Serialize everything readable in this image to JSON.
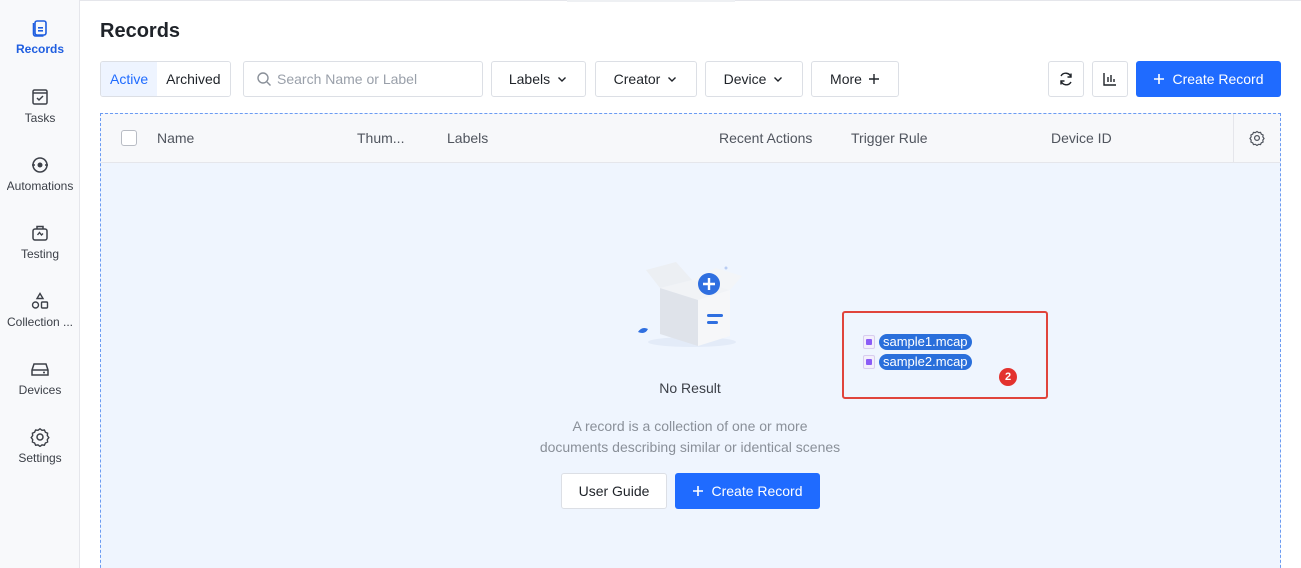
{
  "sidebar": {
    "items": [
      {
        "label": "Records",
        "icon": "records-icon",
        "active": true
      },
      {
        "label": "Tasks",
        "icon": "tasks-icon"
      },
      {
        "label": "Automations",
        "icon": "automations-icon"
      },
      {
        "label": "Testing",
        "icon": "testing-icon"
      },
      {
        "label": "Collection ...",
        "icon": "collection-icon"
      },
      {
        "label": "Devices",
        "icon": "devices-icon"
      },
      {
        "label": "Settings",
        "icon": "gear-icon"
      }
    ]
  },
  "page": {
    "title": "Records"
  },
  "toolbar": {
    "tabs": [
      {
        "label": "Active",
        "active": true
      },
      {
        "label": "Archived"
      }
    ],
    "search_placeholder": "Search Name or Label",
    "filters": {
      "labels": "Labels",
      "creator": "Creator",
      "device": "Device",
      "more": "More"
    },
    "create_label": "Create Record"
  },
  "table": {
    "columns": [
      "Name",
      "Thum...",
      "Labels",
      "Recent Actions",
      "Trigger Rule",
      "Device ID"
    ]
  },
  "empty": {
    "title": "No Result",
    "desc_line1": "A record is a collection of one or more",
    "desc_line2": "documents describing similar or identical scenes",
    "guide_label": "User Guide",
    "create_label": "Create Record"
  },
  "drag": {
    "files": [
      "sample1.mcap",
      "sample2.mcap"
    ],
    "count": "2"
  },
  "colors": {
    "accent": "#1f6bff",
    "drop_border": "#6b9bf2",
    "drop_bg": "#eff5fe",
    "highlight": "#e0443c"
  }
}
